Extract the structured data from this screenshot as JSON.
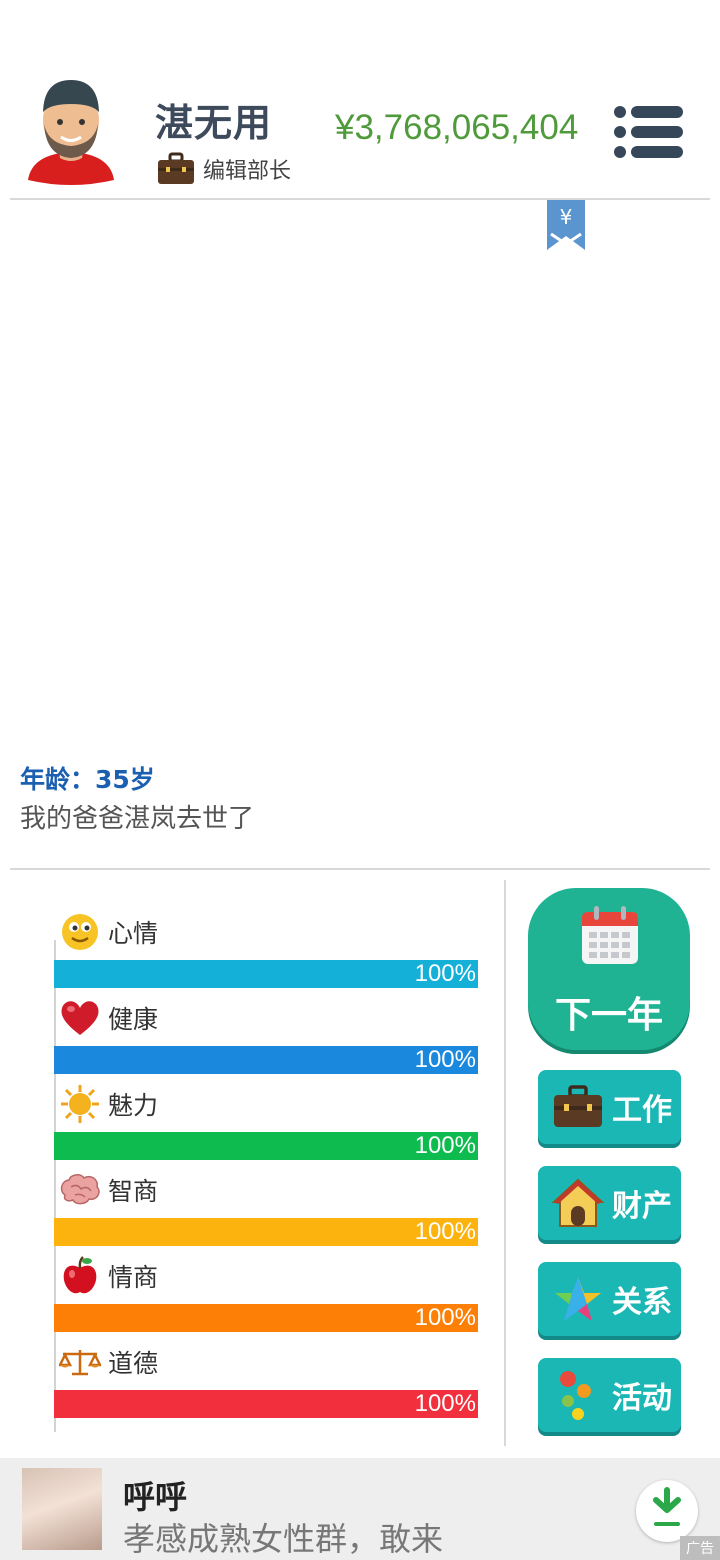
{
  "player": {
    "name": "湛无用",
    "job_title": "编辑部长",
    "money": "¥3,768,065,404"
  },
  "bookmark": {
    "symbol": "¥"
  },
  "log": {
    "age_text": "年龄：35岁",
    "event_text": "我的爸爸湛岚去世了"
  },
  "stats": [
    {
      "name": "心情",
      "percent_text": "100%",
      "value": 100,
      "color": "#14b0d8",
      "icon": "smiley-icon"
    },
    {
      "name": "健康",
      "percent_text": "100%",
      "value": 100,
      "color": "#1a88dc",
      "icon": "heart-icon"
    },
    {
      "name": "魅力",
      "percent_text": "100%",
      "value": 100,
      "color": "#0dbb4f",
      "icon": "sun-icon"
    },
    {
      "name": "智商",
      "percent_text": "100%",
      "value": 100,
      "color": "#fdb30d",
      "icon": "brain-icon"
    },
    {
      "name": "情商",
      "percent_text": "100%",
      "value": 100,
      "color": "#fd7f06",
      "icon": "apple-icon"
    },
    {
      "name": "道德",
      "percent_text": "100%",
      "value": 100,
      "color": "#f12f3d",
      "icon": "scales-icon"
    }
  ],
  "buttons": {
    "next_year": "下一年",
    "work": "工作",
    "assets": "财产",
    "relations": "关系",
    "activities": "活动"
  },
  "ad": {
    "title": "呼呼",
    "description": "孝感成熟女性群，敢来",
    "tag": "广告"
  }
}
